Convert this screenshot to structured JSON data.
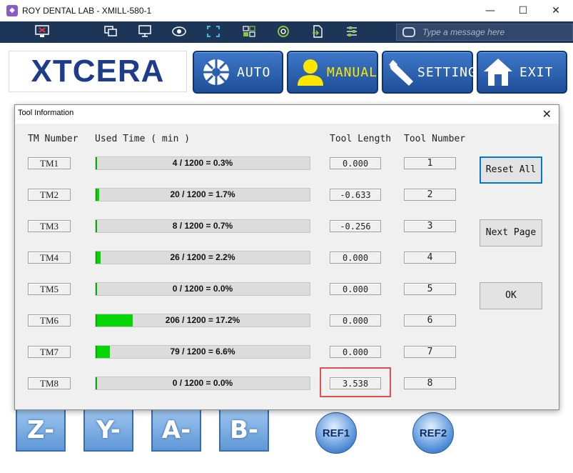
{
  "window": {
    "title": "ROY DENTAL LAB - XMILL-580-1",
    "minimize": "—",
    "maximize": "☐",
    "close": "✕"
  },
  "toolbar": {
    "message_placeholder": "Type a message here"
  },
  "app": {
    "logo": "XTCERA",
    "nav": [
      {
        "label": "AUTO",
        "icon": "wheel-icon"
      },
      {
        "label": "MANUAL",
        "icon": "user-icon",
        "active": true
      },
      {
        "label": "SETTING",
        "icon": "wrench-icon"
      },
      {
        "label": "EXIT",
        "icon": "home-icon"
      }
    ],
    "axis_buttons": [
      "Z-",
      "Y-",
      "A-",
      "B-"
    ],
    "ref_buttons": [
      "REF1",
      "REF2"
    ]
  },
  "dialog": {
    "title": "Tool Information",
    "close": "✕",
    "headers": {
      "tm_number": "TM Number",
      "used_time": "Used Time ( min )",
      "tool_length": "Tool Length",
      "tool_number": "Tool Number"
    },
    "rows": [
      {
        "tm": "TM1",
        "usage": "4 / 1200 = 0.3%",
        "pct": 0.3,
        "length": "0.000",
        "number": "1"
      },
      {
        "tm": "TM2",
        "usage": "20 / 1200 = 1.7%",
        "pct": 1.7,
        "length": "-0.633",
        "number": "2"
      },
      {
        "tm": "TM3",
        "usage": "8 / 1200 = 0.7%",
        "pct": 0.7,
        "length": "-0.256",
        "number": "3"
      },
      {
        "tm": "TM4",
        "usage": "26 / 1200 = 2.2%",
        "pct": 2.2,
        "length": "0.000",
        "number": "4"
      },
      {
        "tm": "TM5",
        "usage": "0 / 1200 = 0.0%",
        "pct": 0.0,
        "length": "0.000",
        "number": "5"
      },
      {
        "tm": "TM6",
        "usage": "206 / 1200 = 17.2%",
        "pct": 17.2,
        "length": "0.000",
        "number": "6"
      },
      {
        "tm": "TM7",
        "usage": "79 / 1200 = 6.6%",
        "pct": 6.6,
        "length": "0.000",
        "number": "7"
      },
      {
        "tm": "TM8",
        "usage": "0 / 1200 = 0.0%",
        "pct": 0.0,
        "length": "3.538",
        "number": "8"
      }
    ],
    "buttons": {
      "reset_all": "Reset All",
      "next_page": "Next Page",
      "ok": "OK"
    },
    "colors": {
      "progress_fill": "#06d606",
      "highlight": "#e05050"
    }
  }
}
